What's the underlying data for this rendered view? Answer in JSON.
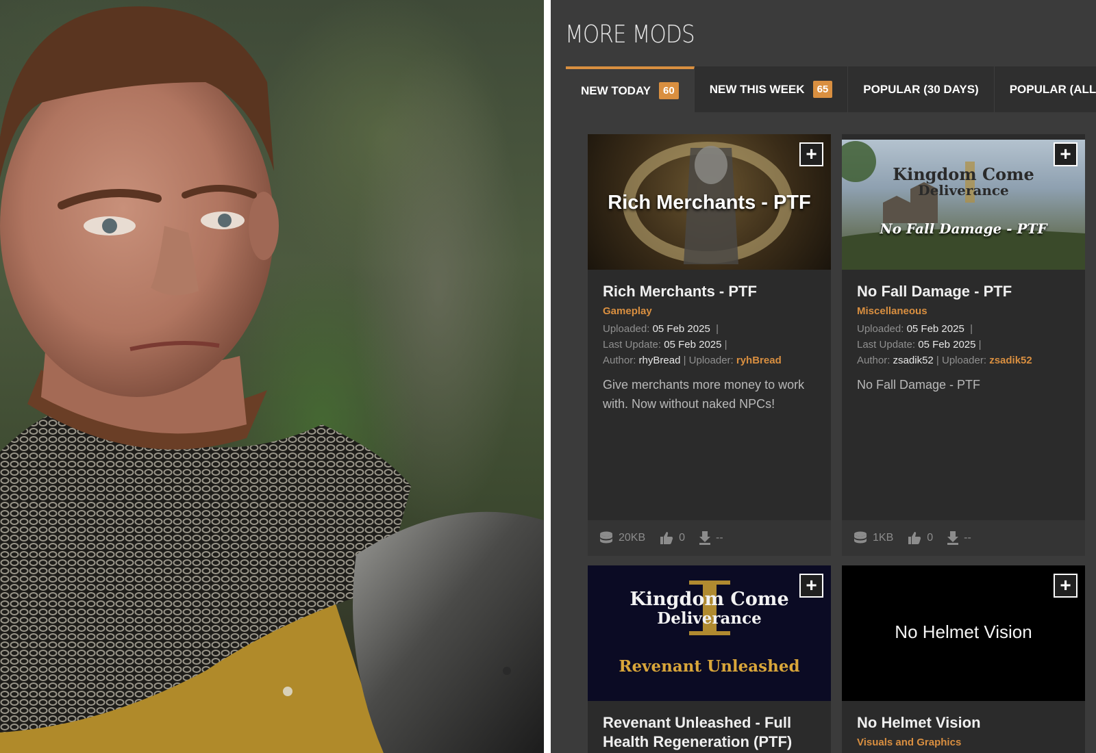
{
  "section_title": "MORE MODS",
  "tabs": [
    {
      "label": "NEW TODAY",
      "badge": "60",
      "active": true
    },
    {
      "label": "NEW THIS WEEK",
      "badge": "65",
      "active": false
    },
    {
      "label": "POPULAR (30 DAYS)",
      "badge": "",
      "active": false
    },
    {
      "label": "POPULAR (ALL",
      "badge": "",
      "active": false
    }
  ],
  "labels": {
    "uploaded": "Uploaded:",
    "last_update": "Last Update:",
    "author": "Author:",
    "uploader": "Uploader:"
  },
  "mods": [
    {
      "thumb_text": "Rich Merchants - PTF",
      "title": "Rich Merchants - PTF",
      "category": "Gameplay",
      "uploaded": "05 Feb 2025",
      "last_update": "05 Feb 2025",
      "author": "rhyBread",
      "uploader": "ryhBread",
      "description": "Give merchants more money to work with. Now without naked NPCs!",
      "size": "20KB",
      "endorsements": "0",
      "downloads": "--"
    },
    {
      "thumb_text": "No Fall Damage - PTF",
      "thumb_logo_1": "Kingdom Come",
      "thumb_logo_2": "Deliverance",
      "title": "No Fall Damage - PTF",
      "category": "Miscellaneous",
      "uploaded": "05 Feb 2025",
      "last_update": "05 Feb 2025",
      "author": "zsadik52",
      "uploader": "zsadik52",
      "description": "No Fall Damage - PTF",
      "size": "1KB",
      "endorsements": "0",
      "downloads": "--"
    },
    {
      "thumb_logo_1": "Kingdom Come",
      "thumb_logo_2": "Deliverance",
      "thumb_text": "Revenant Unleashed",
      "title": "Revenant Unleashed - Full Health Regeneration (PTF)"
    },
    {
      "thumb_text": "No Helmet Vision",
      "title": "No Helmet Vision",
      "category": "Visuals and Graphics"
    }
  ],
  "colors": {
    "accent": "#d98f40",
    "panel": "#3b3b3b",
    "card": "#2b2b2b"
  },
  "icons": [
    "plus-icon",
    "file-size-icon",
    "thumbs-up-icon",
    "download-icon"
  ]
}
